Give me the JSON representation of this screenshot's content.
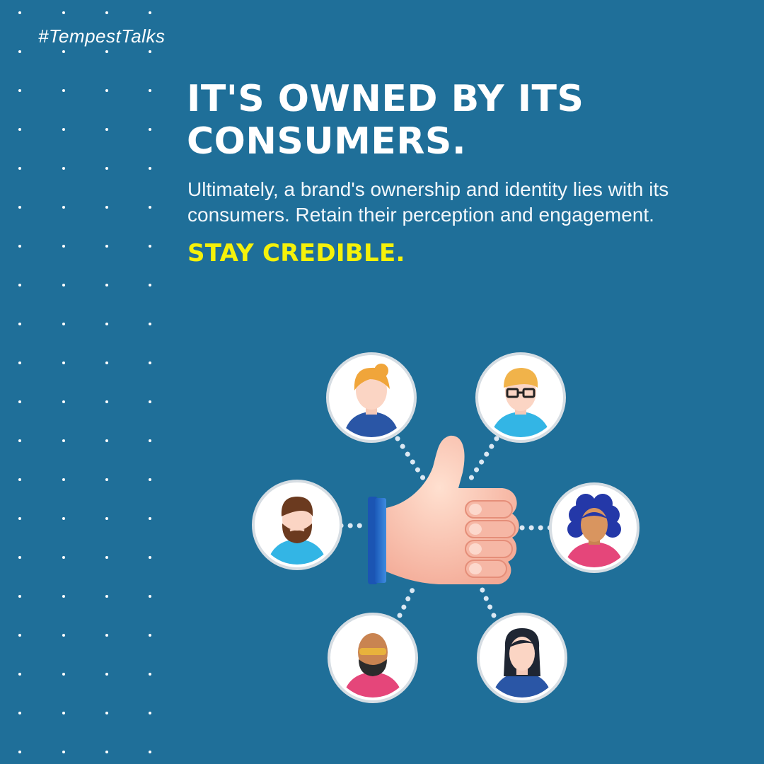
{
  "hashtag": "#TempestTalks",
  "headline": {
    "line1": "IT'S OWNED BY ITS",
    "line2": "CONSUMERS."
  },
  "body": {
    "line1": "Ultimately, a brand's ownership and identity lies with its",
    "line2": "consumers. Retain their perception and engagement."
  },
  "tagline": "STAY CREDIBLE.",
  "colors": {
    "background": "#1f6f99",
    "text": "#ffffff",
    "accent": "#f5f10a"
  },
  "illustration": {
    "center_icon": "thumbs-up-icon",
    "avatars": [
      "woman-avatar-icon",
      "man-with-glasses-avatar-icon",
      "bearded-man-avatar-icon",
      "curly-hair-woman-avatar-icon",
      "bald-man-with-sunglasses-avatar-icon",
      "dark-hair-woman-avatar-icon"
    ]
  }
}
